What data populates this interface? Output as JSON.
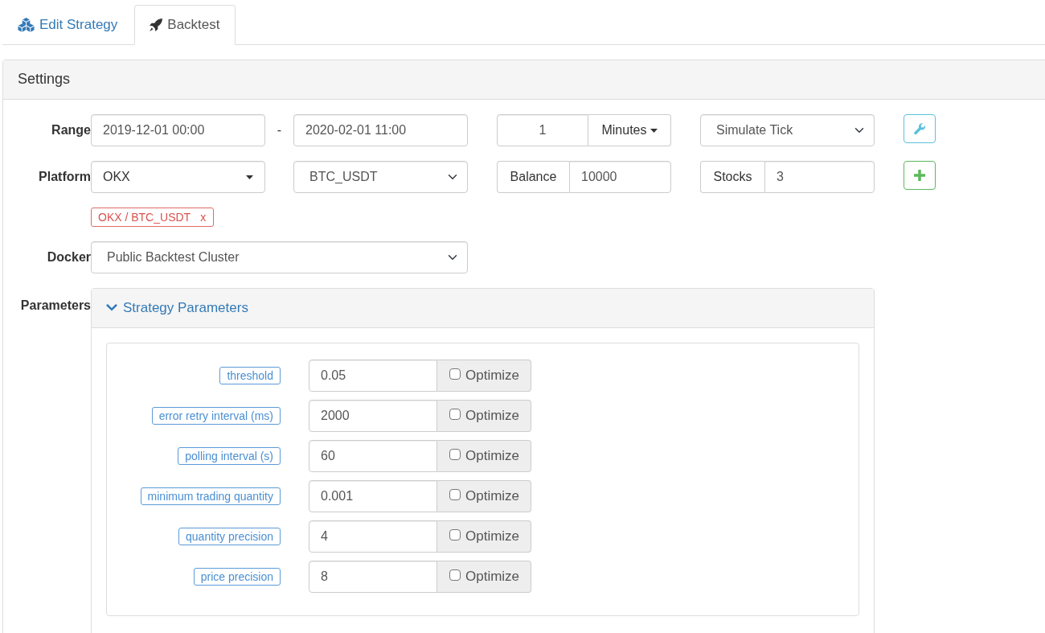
{
  "tabs": [
    {
      "label": "Edit Strategy",
      "selected": false
    },
    {
      "label": "Backtest",
      "selected": true
    }
  ],
  "settings": {
    "title": "Settings",
    "range": {
      "label": "Range",
      "start": "2019-12-01 00:00",
      "separator": "-",
      "end": "2020-02-01 11:00",
      "period": "1",
      "period_unit": "Minutes",
      "mode": "Simulate Tick"
    },
    "platform": {
      "label": "Platform",
      "exchange": "OKX",
      "pair": "BTC_USDT",
      "balance_label": "Balance",
      "balance": "10000",
      "stocks_label": "Stocks",
      "stocks": "3"
    },
    "selected_pairs": [
      {
        "text": "OKX / BTC_USDT",
        "remove": "x"
      }
    ],
    "docker": {
      "label": "Docker",
      "value": "Public Backtest Cluster"
    },
    "parameters": {
      "label": "Parameters",
      "group_title": "Strategy Parameters",
      "expanded": true,
      "items": [
        {
          "name": "threshold",
          "value": "0.05",
          "optimize_label": "Optimize",
          "checked": false
        },
        {
          "name": "error retry interval (ms)",
          "value": "2000",
          "optimize_label": "Optimize",
          "checked": false
        },
        {
          "name": "polling interval (s)",
          "value": "60",
          "optimize_label": "Optimize",
          "checked": false
        },
        {
          "name": "minimum trading quantity",
          "value": "0.001",
          "optimize_label": "Optimize",
          "checked": false
        },
        {
          "name": "quantity precision",
          "value": "4",
          "optimize_label": "Optimize",
          "checked": false
        },
        {
          "name": "price precision",
          "value": "8",
          "optimize_label": "Optimize",
          "checked": false
        }
      ]
    }
  }
}
